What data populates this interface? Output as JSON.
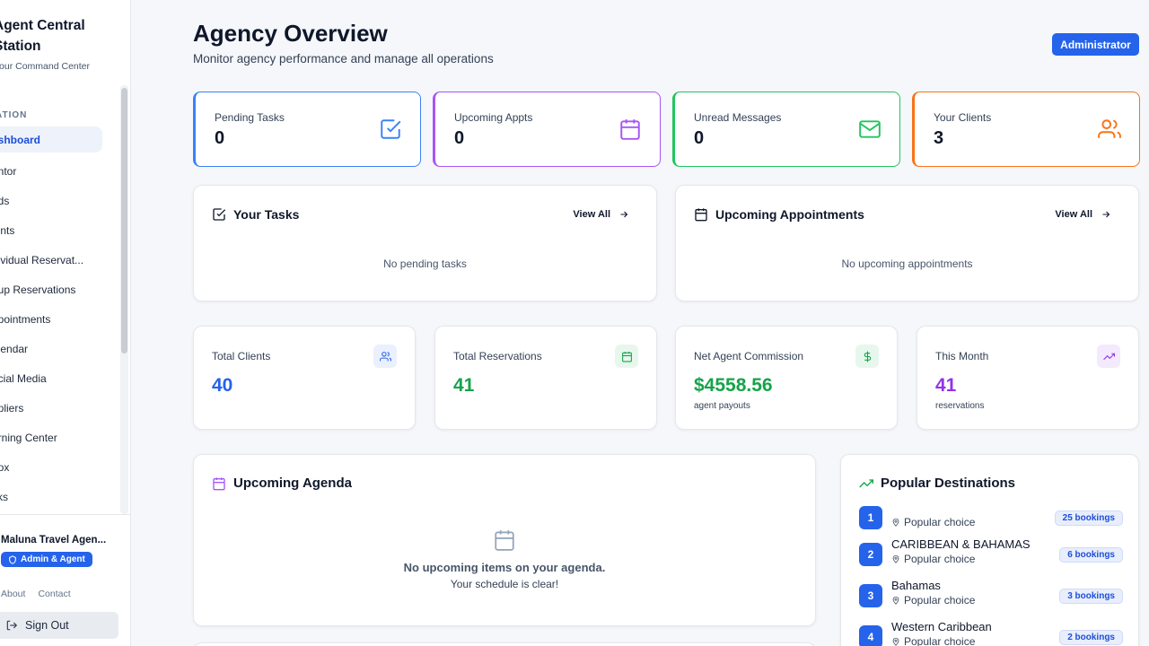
{
  "sidebar": {
    "brand_line1": "Agent Central",
    "brand_line2": "Station",
    "brand_sub": "Your Command Center",
    "section": "ATION",
    "items": [
      {
        "label": "ashboard",
        "active": true
      },
      {
        "label": "entor"
      },
      {
        "label": "ads"
      },
      {
        "label": "ients"
      },
      {
        "label": "dividual Reservat..."
      },
      {
        "label": "oup Reservations"
      },
      {
        "label": "ppointments"
      },
      {
        "label": "alendar"
      },
      {
        "label": "ocial Media"
      },
      {
        "label": "ppliers"
      },
      {
        "label": "arning Center"
      },
      {
        "label": "box"
      },
      {
        "label": "sks"
      }
    ],
    "agency_name": "Maluna Travel Agen...",
    "role": "Admin & Agent",
    "links": {
      "about": "About",
      "contact": "Contact"
    },
    "sign_out": "Sign Out"
  },
  "header": {
    "title": "Agency Overview",
    "subtitle": "Monitor agency performance and manage all operations",
    "role_button": "Administrator"
  },
  "stats": [
    {
      "label": "Pending Tasks",
      "value": "0",
      "color": "#3b82f6",
      "icon": "check-square-icon"
    },
    {
      "label": "Upcoming Appts",
      "value": "0",
      "color": "#a855f7",
      "icon": "calendar-icon"
    },
    {
      "label": "Unread Messages",
      "value": "0",
      "color": "#22c55e",
      "icon": "mail-icon"
    },
    {
      "label": "Your Clients",
      "value": "3",
      "color": "#f97316",
      "icon": "users-icon"
    }
  ],
  "tasks_card": {
    "title": "Your Tasks",
    "view_all": "View All",
    "empty": "No pending tasks"
  },
  "appointments_card": {
    "title": "Upcoming Appointments",
    "view_all": "View All",
    "empty": "No upcoming appointments"
  },
  "metrics": [
    {
      "label": "Total Clients",
      "value": "40",
      "caption": "",
      "color": "#2563eb",
      "icon": "users-icon"
    },
    {
      "label": "Total Reservations",
      "value": "41",
      "caption": "",
      "color": "#16a34a",
      "icon": "calendar-icon"
    },
    {
      "label": "Net Agent Commission",
      "value": "$4558.56",
      "caption": "agent payouts",
      "color": "#16a34a",
      "icon": "dollar-icon"
    },
    {
      "label": "This Month",
      "value": "41",
      "caption": "reservations",
      "color": "#9333ea",
      "icon": "trending-up-icon"
    }
  ],
  "agenda": {
    "title": "Upcoming Agenda",
    "empty_title": "No upcoming items on your agenda.",
    "empty_sub": "Your schedule is clear!"
  },
  "destinations": {
    "title": "Popular Destinations",
    "items": [
      {
        "rank": "1",
        "name": "",
        "sub": "Popular choice",
        "bookings": "25 bookings"
      },
      {
        "rank": "2",
        "name": "CARIBBEAN & BAHAMAS",
        "sub": "Popular choice",
        "bookings": "6 bookings"
      },
      {
        "rank": "3",
        "name": "Bahamas",
        "sub": "Popular choice",
        "bookings": "3 bookings"
      },
      {
        "rank": "4",
        "name": "Western Caribbean",
        "sub": "Popular choice",
        "bookings": "2 bookings"
      }
    ]
  }
}
